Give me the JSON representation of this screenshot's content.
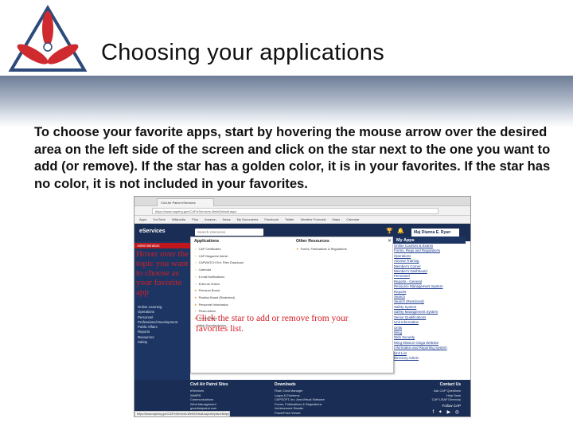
{
  "slide": {
    "title": "Choosing your applications",
    "body": "To choose your favorite apps, start by hovering the mouse arrow over the desired area on the left side of the screen and click on the star next to the one you want to add (or remove). If the star has a golden color, it is in your favorites.  If the star has no color, it is not included in your favorites."
  },
  "colors": {
    "accent": "#d32027",
    "nav": "#1d3563",
    "star": "#e2a21b"
  },
  "browser": {
    "tab": "Civil Air Patrol eServices",
    "url": "https://www.capnhq.gov/CAP.eServices.Web/Default.aspx",
    "bookmarks": [
      "Apps",
      "YouTube",
      "Wikipedia",
      "Plus",
      "Amazon",
      "News",
      "My Documents",
      "Facebook",
      "Twitter",
      "Weather Forecast",
      "Maps",
      "Calendar"
    ]
  },
  "eservices": {
    "logo": "eServices",
    "search_placeholder": "Search eServices",
    "user": "Maj Dianna E. Ryan",
    "active_nav": "Administration",
    "hover_note": "Hover over the topic you want to choose as your favorite app",
    "nav_items": [
      "Online Learning",
      "Operations",
      "Personnel",
      "Professional Development",
      "Public Affairs",
      "Reports",
      "Resources",
      "Safety"
    ],
    "applications_heading": "Applications",
    "applications": [
      "CAP Certificates",
      "CAP Magazine Admin",
      "CAPWATCH Ent. Files Download",
      "Calendar",
      "E-mail Notifications",
      "External Orders",
      "Premium Board",
      "Position Board (Restricted)",
      "Personnel Information",
      "Photo Admin",
      "Photo Upload",
      "Web Security Admin"
    ],
    "other_heading": "Other Resources",
    "other": [
      "Forms, Publications & Regulations"
    ],
    "click_note": "Click the star to add or remove from your favorites list.",
    "myapps_heading": "My Apps",
    "myapps": [
      "Online Courses & Exams",
      "Forms, Regs and Regulations",
      "Operations",
      "Aircrew Training",
      "Member's Corner",
      "Member's Dashboard",
      "Personnel",
      "Reports - General",
      "Resource Management System",
      "Reports",
      "Search",
      "Search (Restricted)",
      "Safety System",
      "Safety Management System",
      "Senior Qualifications",
      "Unit Information",
      "Units",
      "Wing",
      "Web Security",
      "Wing Mission Oinga Website",
      "Information and Reporting System",
      "Unit List",
      "Directory Admin"
    ]
  },
  "footer": {
    "col1_head": "Civil Air Patrol Sites",
    "col1": [
      "eServices",
      "WMIRS",
      "Communications",
      "Wind Management",
      "gocivilairpatrol.com",
      "capmembers.com"
    ],
    "col2_head": "Downloads",
    "col2": [
      "Flash Card Manager",
      "Logos & Emblems",
      "CAPSOFT, Inc. AeroVirtual Software",
      "Forms, Publications & Regulations",
      "Achievement Reader",
      "PowerPoint Viewer"
    ],
    "col3_head": "Contact Us",
    "col3": [
      "Ask CAP Questions",
      "Help Desk",
      "CAP-USAF Directory"
    ],
    "follow": "Follow CAP",
    "social": "f ✦ ▶ ◎",
    "status": "https://www.capnhq.gov/CAP.eServices.Web/Default.aspx#myfavoriteapps"
  }
}
